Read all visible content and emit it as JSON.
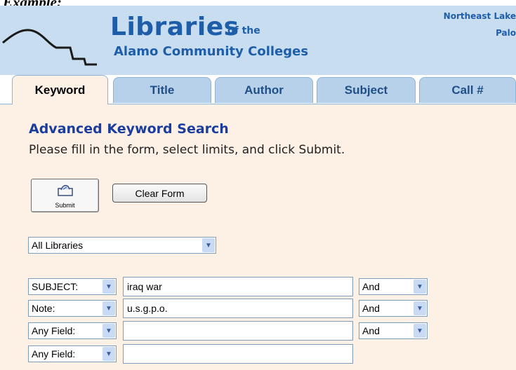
{
  "caption": "Example:",
  "header": {
    "brand_big": "Libraries",
    "brand_small": "of the",
    "brand_sub": "Alamo Community Colleges",
    "campus_1": "Northeast Lake",
    "campus_2": "Palo"
  },
  "tabs": [
    {
      "label": "Keyword",
      "active": true
    },
    {
      "label": "Title"
    },
    {
      "label": "Author"
    },
    {
      "label": "Subject"
    },
    {
      "label": "Call #"
    }
  ],
  "form": {
    "title": "Advanced Keyword Search",
    "instructions": "Please fill in the form, select limits, and click Submit.",
    "submit_label": "Submit",
    "clear_label": "Clear Form",
    "library_select": "All Libraries",
    "rows": [
      {
        "field": "SUBJECT:",
        "term": "iraq war",
        "op": "And"
      },
      {
        "field": "Note:",
        "term": "u.s.g.p.o.",
        "op": "And"
      },
      {
        "field": "Any Field:",
        "term": "",
        "op": "And"
      },
      {
        "field": "Any Field:",
        "term": ""
      }
    ]
  },
  "colors": {
    "header_bg": "#c9ddf1",
    "brand_blue": "#1e5ea8",
    "panel_bg": "#fdf1e6",
    "tab_bg": "#b8d1ea"
  }
}
